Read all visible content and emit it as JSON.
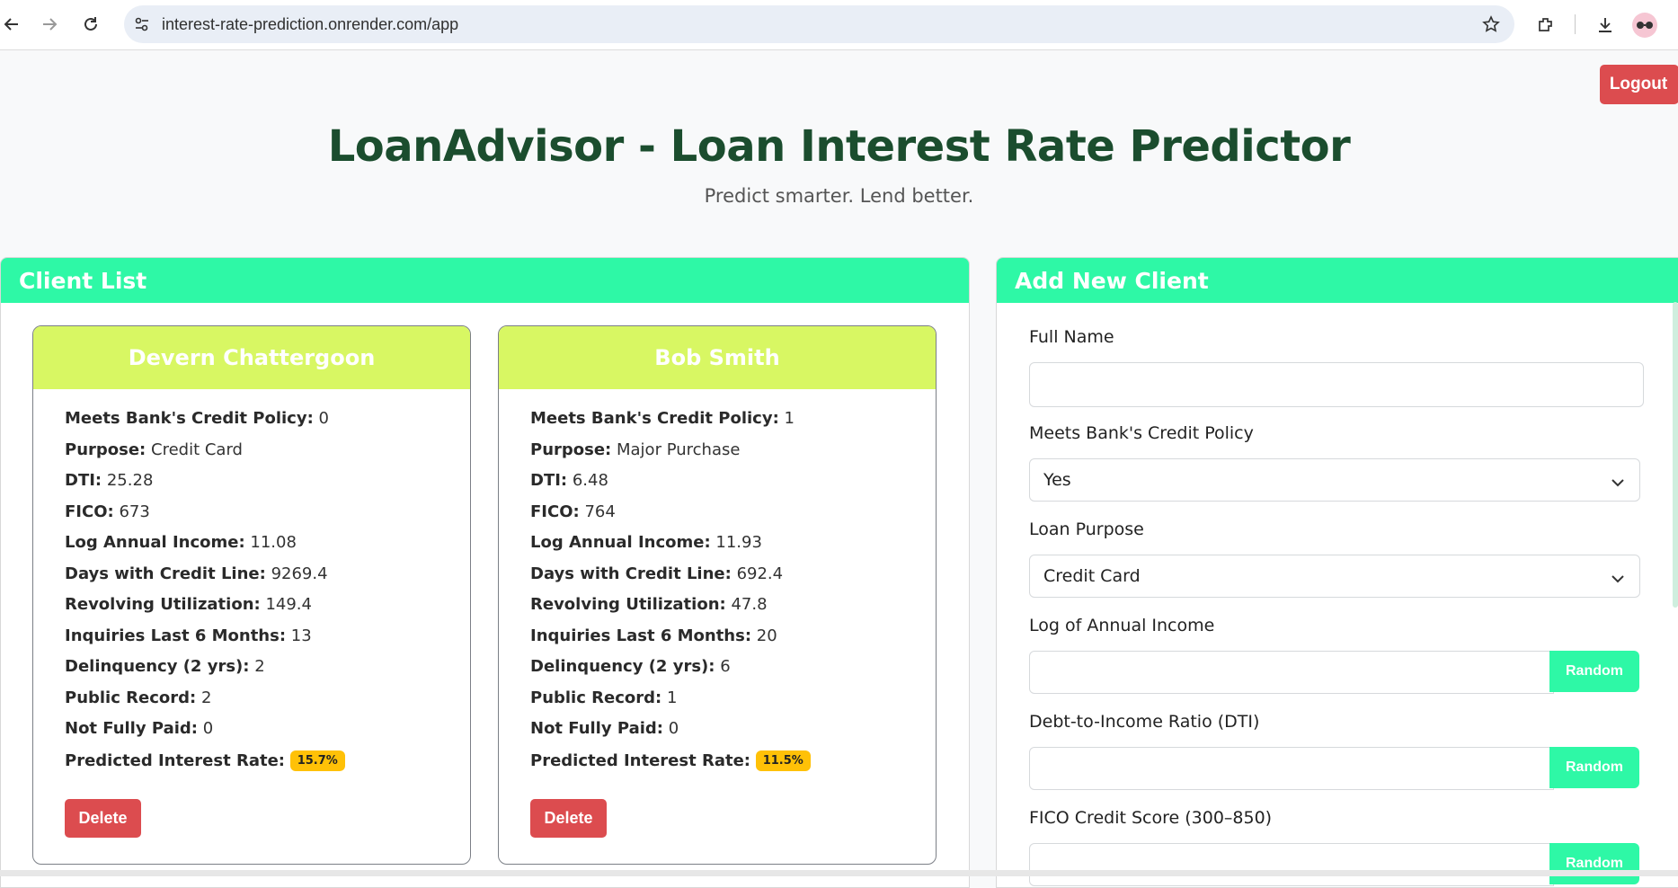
{
  "browser": {
    "url": "interest-rate-prediction.onrender.com/app"
  },
  "header": {
    "logout_label": "Logout",
    "title": "LoanAdvisor - Loan Interest Rate Predictor",
    "subtitle": "Predict smarter. Lend better."
  },
  "client_list": {
    "heading": "Client List",
    "field_labels": {
      "policy": "Meets Bank's Credit Policy:",
      "purpose": "Purpose:",
      "dti": "DTI:",
      "fico": "FICO:",
      "log_income": "Log Annual Income:",
      "days_credit": "Days with Credit Line:",
      "revol_util": "Revolving Utilization:",
      "inquiries": "Inquiries Last 6 Months:",
      "delinquency": "Delinquency (2 yrs):",
      "public_record": "Public Record:",
      "not_fully_paid": "Not Fully Paid:",
      "predicted_rate": "Predicted Interest Rate:"
    },
    "delete_label": "Delete",
    "clients": [
      {
        "name": "Devern Chattergoon",
        "policy": "0",
        "purpose": "Credit Card",
        "dti": "25.28",
        "fico": "673",
        "log_income": "11.08",
        "days_credit": "9269.4",
        "revol_util": "149.4",
        "inquiries": "13",
        "delinquency": "2",
        "public_record": "2",
        "not_fully_paid": "0",
        "predicted_rate": "15.7%"
      },
      {
        "name": "Bob Smith",
        "policy": "1",
        "purpose": "Major Purchase",
        "dti": "6.48",
        "fico": "764",
        "log_income": "11.93",
        "days_credit": "692.4",
        "revol_util": "47.8",
        "inquiries": "20",
        "delinquency": "6",
        "public_record": "1",
        "not_fully_paid": "0",
        "predicted_rate": "11.5%"
      }
    ]
  },
  "add_client": {
    "heading": "Add New Client",
    "full_name_label": "Full Name",
    "full_name_value": "",
    "policy_label": "Meets Bank's Credit Policy",
    "policy_value": "Yes",
    "purpose_label": "Loan Purpose",
    "purpose_value": "Credit Card",
    "log_income_label": "Log of Annual Income",
    "dti_label": "Debt-to-Income Ratio (DTI)",
    "fico_label": "FICO Credit Score (300–850)",
    "random_label": "Random"
  },
  "colors": {
    "accent_green": "#2ef8a6",
    "card_header_lime": "#d8f763",
    "danger_red": "#dc4c4f",
    "badge_yellow": "#ffc107",
    "title_green": "#1b4d2e"
  }
}
